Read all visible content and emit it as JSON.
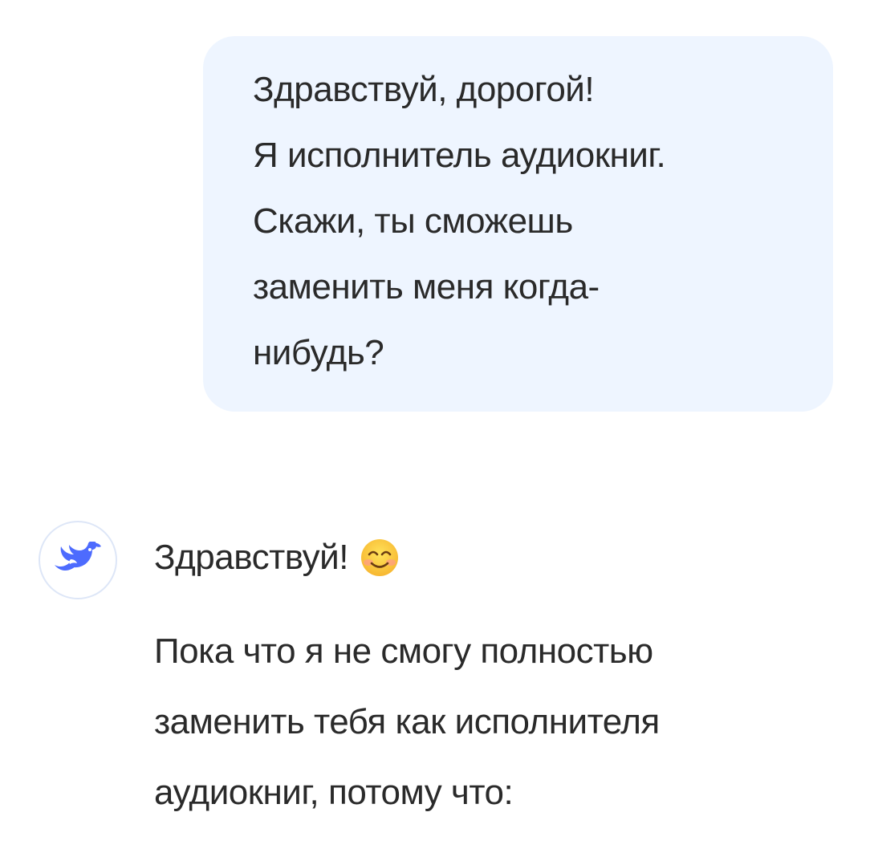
{
  "user_message": {
    "lines": [
      "Здравствуй, дорогой!",
      "Я исполнитель аудиокниг.",
      "Скажи, ты сможешь",
      "заменить меня когда-",
      "нибудь?"
    ]
  },
  "assistant_message": {
    "avatar_icon": "whale-logo-icon",
    "greeting": "Здравствуй!",
    "greeting_emoji": "smiling-face-icon",
    "reply_lines": [
      "Пока что я не смогу полностью",
      "заменить тебя как исполнителя",
      "аудиокниг, потому что:"
    ]
  },
  "colors": {
    "user_bubble_bg": "#eef5ff",
    "text": "#2a2a2a",
    "brand": "#4d6bfe",
    "avatar_border": "#dde6f7"
  }
}
